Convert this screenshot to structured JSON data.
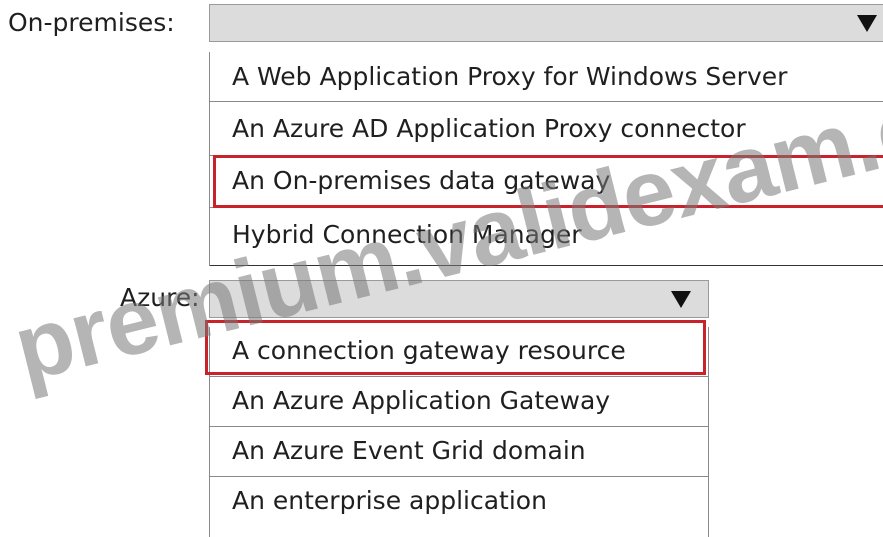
{
  "onprem": {
    "label": "On-premises:",
    "selected": "",
    "options": [
      "A Web Application Proxy for Windows Server",
      "An Azure AD Application Proxy connector",
      "An On-premises data gateway",
      "Hybrid Connection Manager"
    ],
    "highlighted_option": "An On-premises data gateway"
  },
  "azure": {
    "label": "Azure:",
    "selected": "",
    "options": [
      "A connection gateway resource",
      "An Azure Application Gateway",
      "An Azure Event Grid domain",
      "An enterprise application"
    ],
    "highlighted_option": "A connection gateway resource"
  },
  "watermark": "premium.validexam.com",
  "colors": {
    "highlight_border": "#c8232c",
    "dropdown_fill": "#dcdcdc",
    "watermark": "#787878"
  },
  "icons": {
    "dropdown_arrow": "chevron-down-icon"
  }
}
